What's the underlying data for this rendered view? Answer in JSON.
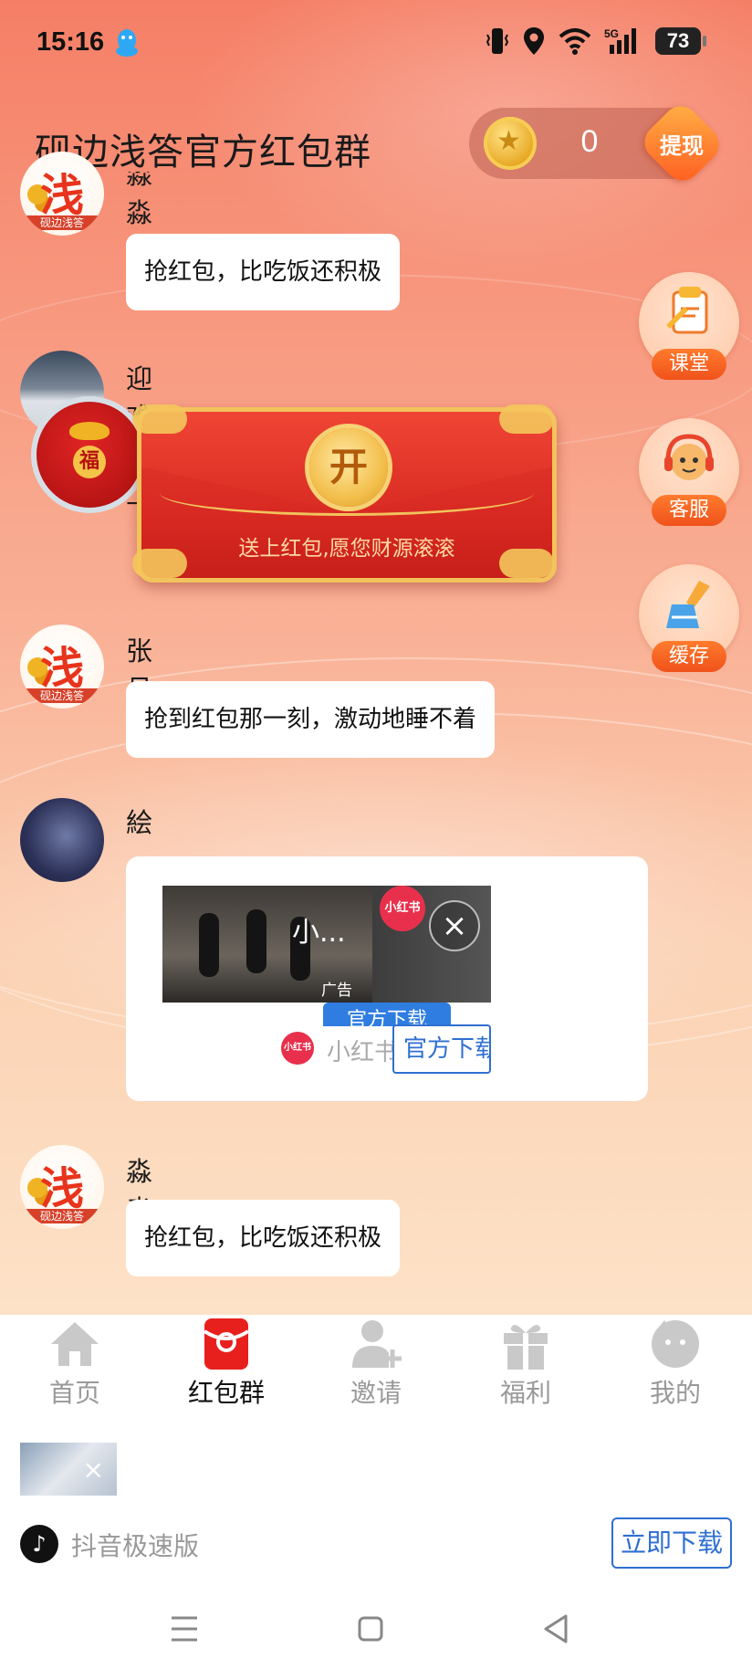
{
  "status_bar": {
    "time": "15:16",
    "network": "5G",
    "battery": "73",
    "icons": [
      "qq-icon",
      "vibrate-icon",
      "location-icon",
      "wifi-icon",
      "signal-icon",
      "battery-icon"
    ]
  },
  "header": {
    "title": "砚边浅答官方红包群",
    "coin_count": "0",
    "withdraw_label": "提现"
  },
  "brand_avatar": {
    "char": "浅",
    "caption": "砚边浅答"
  },
  "messages": [
    {
      "name": "淼淼",
      "text": "抢红包，比吃饭还积极"
    },
    {
      "name": "迎难而上",
      "red_packet": {
        "open_label": "开",
        "caption": "送上红包,愿您财源滚滚",
        "bag_char": "福"
      }
    },
    {
      "name": "张月",
      "text": "抢到红包那一刻，激动地睡不着"
    },
    {
      "name": "絵",
      "ad": {
        "title": "小...",
        "tag": "广告",
        "badge": "小红书",
        "peek_button": "官方下载",
        "brand": "小红书",
        "download": "官方下载"
      }
    },
    {
      "name": "淼淼",
      "text": "抢红包，比吃饭还积极"
    }
  ],
  "side_buttons": [
    {
      "label": "课堂",
      "icon": "notebook-icon"
    },
    {
      "label": "客服",
      "icon": "headset-icon"
    },
    {
      "label": "缓存",
      "icon": "broom-icon"
    }
  ],
  "tabs": [
    {
      "label": "首页",
      "icon": "home-icon",
      "active": false
    },
    {
      "label": "红包群",
      "icon": "red-packet-icon",
      "active": true
    },
    {
      "label": "邀请",
      "icon": "invite-icon",
      "active": false
    },
    {
      "label": "福利",
      "icon": "gift-icon",
      "active": false
    },
    {
      "label": "我的",
      "icon": "profile-icon",
      "active": false
    }
  ],
  "bottom_ad": {
    "app_name": "抖音极速版",
    "button": "立即下载",
    "close": "×"
  },
  "colors": {
    "accent_red": "#e53a2e",
    "gold": "#f2c35c",
    "link_blue": "#2f6fd1",
    "orange": "#f0521b"
  }
}
